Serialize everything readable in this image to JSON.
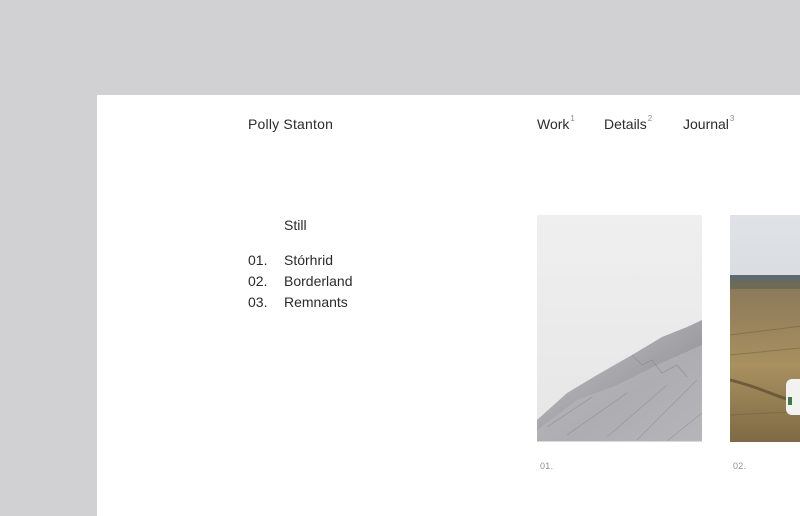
{
  "site": {
    "title": "Polly Stanton"
  },
  "nav": {
    "items": [
      {
        "label": "Work",
        "index": "1"
      },
      {
        "label": "Details",
        "index": "2"
      },
      {
        "label": "Journal",
        "index": "3"
      }
    ]
  },
  "main": {
    "section_heading": "Still",
    "projects": [
      {
        "number": "01.",
        "name": "Stórhrid"
      },
      {
        "number": "02.",
        "name": "Borderland"
      },
      {
        "number": "03.",
        "name": "Remnants"
      }
    ]
  },
  "gallery": {
    "images": [
      {
        "caption": "01.",
        "subject": "snowy-mountain-slope"
      },
      {
        "caption": "02.",
        "subject": "grassland-under-overcast-sky"
      }
    ]
  }
}
